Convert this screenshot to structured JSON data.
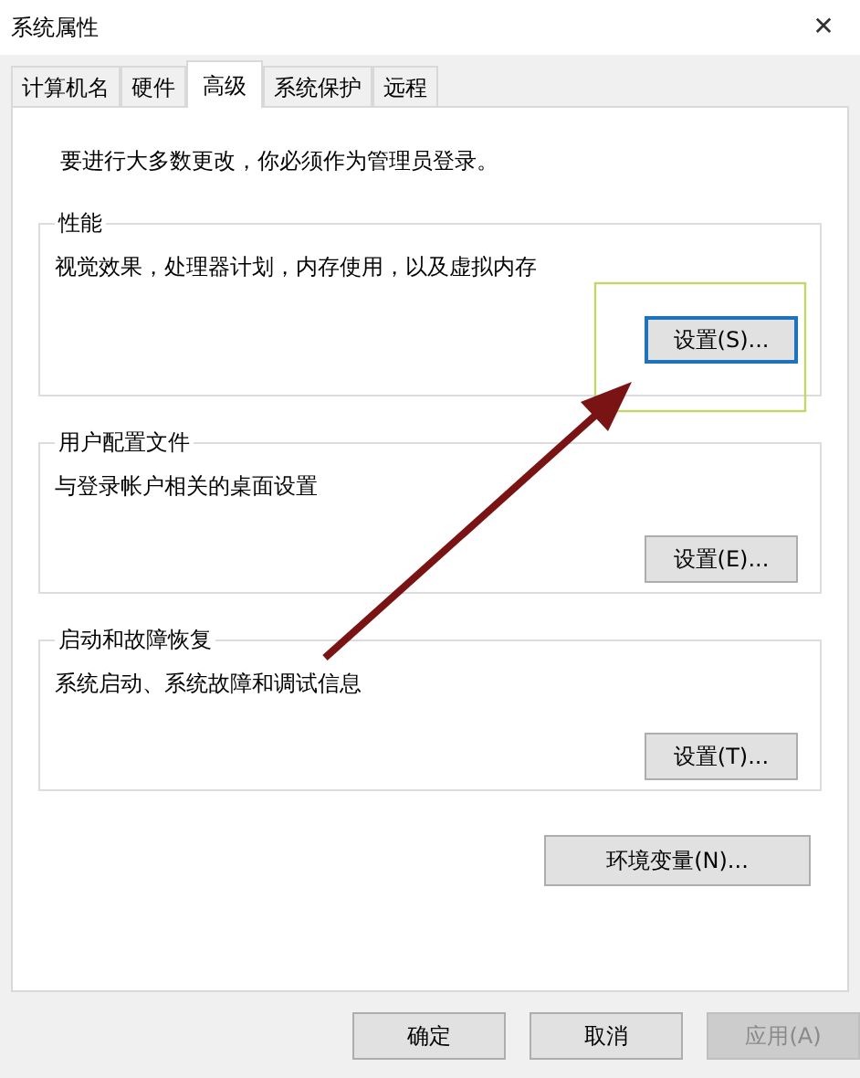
{
  "window": {
    "title": "系统属性",
    "close": "✕"
  },
  "tabs": [
    {
      "label": "计算机名",
      "selected": false
    },
    {
      "label": "硬件",
      "selected": false
    },
    {
      "label": "高级",
      "selected": true
    },
    {
      "label": "系统保护",
      "selected": false
    },
    {
      "label": "远程",
      "selected": false
    }
  ],
  "notice": "要进行大多数更改，你必须作为管理员登录。",
  "groups": [
    {
      "title": "性能",
      "description": "视觉效果，处理器计划，内存使用，以及虚拟内存",
      "button": {
        "label": "设置(S)...",
        "focused": true
      }
    },
    {
      "title": "用户配置文件",
      "description": "与登录帐户相关的桌面设置",
      "button": {
        "label": "设置(E)...",
        "focused": false
      }
    },
    {
      "title": "启动和故障恢复",
      "description": "系统启动、系统故障和调试信息",
      "button": {
        "label": "设置(T)...",
        "focused": false
      }
    }
  ],
  "env_button": "环境变量(N)...",
  "footer_buttons": [
    {
      "label": "确定",
      "disabled": false
    },
    {
      "label": "取消",
      "disabled": false
    },
    {
      "label": "应用(A)",
      "disabled": true
    }
  ]
}
